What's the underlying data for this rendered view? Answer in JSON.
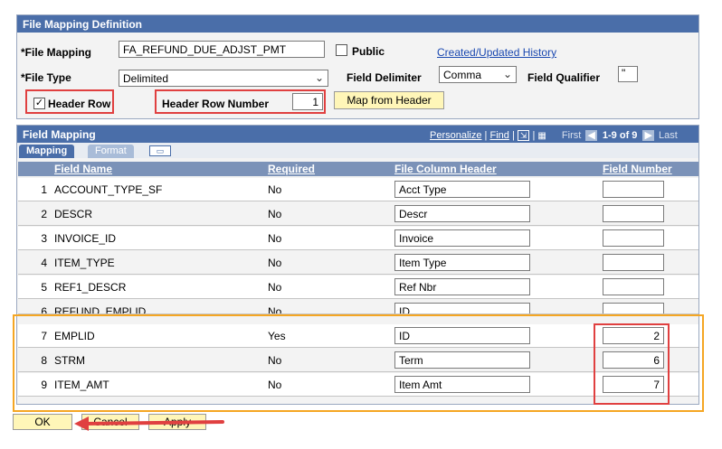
{
  "file_mapping_definition": {
    "title": "File Mapping Definition",
    "file_mapping_label": "*File Mapping",
    "file_mapping_value": "FA_REFUND_DUE_ADJST_PMT",
    "public_label": "Public",
    "created_updated_link": "Created/Updated History",
    "file_type_label": "*File Type",
    "file_type_value": "Delimited",
    "field_delimiter_label": "Field Delimiter",
    "field_delimiter_value": "Comma",
    "field_qualifier_label": "Field Qualifier",
    "field_qualifier_value": "\"",
    "header_row_label": "Header Row",
    "header_row_checked": "✓",
    "header_row_number_label": "Header Row Number",
    "header_row_number_value": "1",
    "map_from_header_button": "Map from Header"
  },
  "field_mapping": {
    "title": "Field Mapping",
    "personalize": "Personalize",
    "find": "Find",
    "sep": "|",
    "first": "First",
    "range": "1-9 of 9",
    "last": "Last",
    "tabs": [
      "Mapping",
      "Format"
    ],
    "columns": [
      "Field Name",
      "Required",
      "File Column Header",
      "Field Number"
    ],
    "rows": [
      {
        "n": "1",
        "field": "ACCOUNT_TYPE_SF",
        "required": "No",
        "header": "Acct Type",
        "number": ""
      },
      {
        "n": "2",
        "field": "DESCR",
        "required": "No",
        "header": "Descr",
        "number": ""
      },
      {
        "n": "3",
        "field": "INVOICE_ID",
        "required": "No",
        "header": "Invoice",
        "number": ""
      },
      {
        "n": "4",
        "field": "ITEM_TYPE",
        "required": "No",
        "header": "Item Type",
        "number": ""
      },
      {
        "n": "5",
        "field": "REF1_DESCR",
        "required": "No",
        "header": "Ref Nbr",
        "number": ""
      },
      {
        "n": "6",
        "field": "REFUND_EMPLID",
        "required": "No",
        "header": "ID",
        "number": ""
      },
      {
        "n": "7",
        "field": "EMPLID",
        "required": "Yes",
        "header": "ID",
        "number": "2"
      },
      {
        "n": "8",
        "field": "STRM",
        "required": "No",
        "header": "Term",
        "number": "6"
      },
      {
        "n": "9",
        "field": "ITEM_AMT",
        "required": "No",
        "header": "Item Amt",
        "number": "7"
      }
    ]
  },
  "buttons": {
    "ok": "OK",
    "cancel": "Cancel",
    "apply": "Apply"
  },
  "colors": {
    "header_blue": "#4a6ea9",
    "annotation_red": "#e04040",
    "annotation_orange": "#f5a623",
    "button_yellow": "#fff6b8"
  }
}
